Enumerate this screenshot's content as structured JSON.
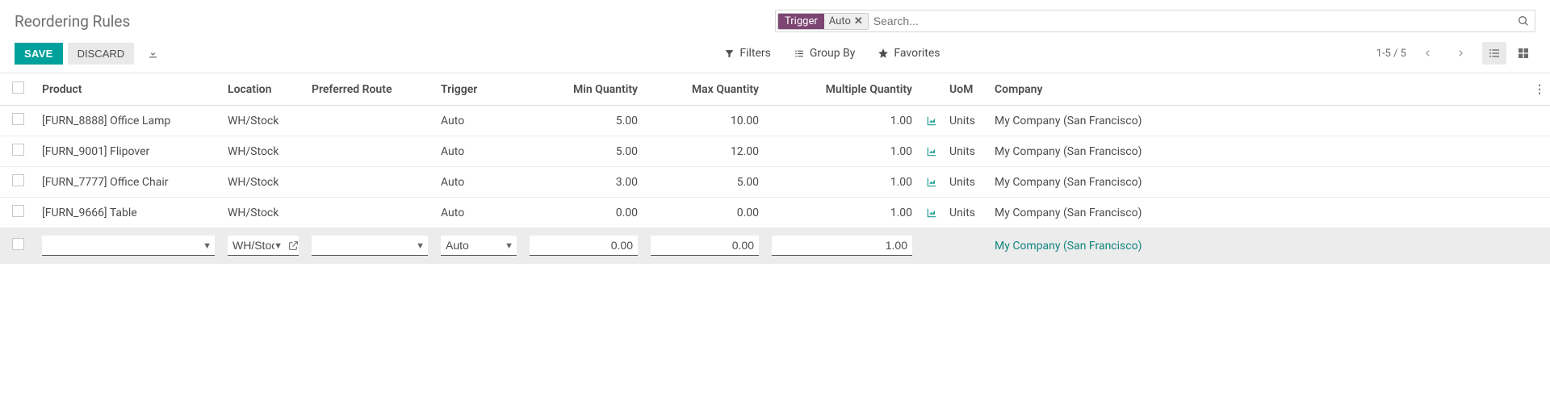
{
  "header": {
    "title": "Reordering Rules",
    "search": {
      "facet_label": "Trigger",
      "facet_value": "Auto",
      "placeholder": "Search..."
    }
  },
  "controls": {
    "save_label": "SAVE",
    "discard_label": "DISCARD",
    "filters_label": "Filters",
    "groupby_label": "Group By",
    "favorites_label": "Favorites",
    "pager": "1-5 / 5"
  },
  "columns": {
    "product": "Product",
    "location": "Location",
    "route": "Preferred Route",
    "trigger": "Trigger",
    "min": "Min Quantity",
    "max": "Max Quantity",
    "mult": "Multiple Quantity",
    "uom": "UoM",
    "company": "Company"
  },
  "rows": [
    {
      "product": "[FURN_8888] Office Lamp",
      "location": "WH/Stock",
      "route": "",
      "trigger": "Auto",
      "min": "5.00",
      "max": "10.00",
      "mult": "1.00",
      "uom": "Units",
      "company": "My Company (San Francisco)"
    },
    {
      "product": "[FURN_9001] Flipover",
      "location": "WH/Stock",
      "route": "",
      "trigger": "Auto",
      "min": "5.00",
      "max": "12.00",
      "mult": "1.00",
      "uom": "Units",
      "company": "My Company (San Francisco)"
    },
    {
      "product": "[FURN_7777] Office Chair",
      "location": "WH/Stock",
      "route": "",
      "trigger": "Auto",
      "min": "3.00",
      "max": "5.00",
      "mult": "1.00",
      "uom": "Units",
      "company": "My Company (San Francisco)"
    },
    {
      "product": "[FURN_9666] Table",
      "location": "WH/Stock",
      "route": "",
      "trigger": "Auto",
      "min": "0.00",
      "max": "0.00",
      "mult": "1.00",
      "uom": "Units",
      "company": "My Company (San Francisco)"
    }
  ],
  "edit_row": {
    "product": "",
    "location": "WH/Stock",
    "route": "",
    "trigger": "Auto",
    "min": "0.00",
    "max": "0.00",
    "mult": "1.00",
    "company": "My Company (San Francisco)"
  }
}
